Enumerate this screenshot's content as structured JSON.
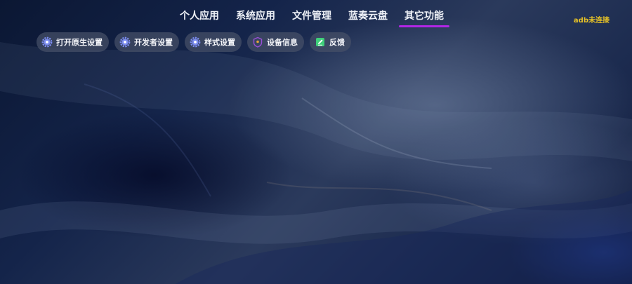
{
  "header": {
    "tabs": [
      {
        "label": "个人应用"
      },
      {
        "label": "系统应用"
      },
      {
        "label": "文件管理"
      },
      {
        "label": "蓝奏云盘"
      },
      {
        "label": "其它功能",
        "active": true
      }
    ],
    "adb_status": "adb未连接"
  },
  "toolbar": {
    "items": [
      {
        "label": "打开原生设置",
        "icon": "gear-icon"
      },
      {
        "label": "开发者设置",
        "icon": "gear-icon"
      },
      {
        "label": "样式设置",
        "icon": "gear-icon"
      },
      {
        "label": "设备信息",
        "icon": "location-pin-icon"
      },
      {
        "label": "反馈",
        "icon": "edit-icon"
      }
    ]
  },
  "colors": {
    "active_tab_indicator": "#b326e6",
    "adb_status_text": "#e7c226",
    "chip_background": "#464f68",
    "gear_icon": "#7b8cf0",
    "pin_icon": "#9a4fd8",
    "edit_icon": "#3fcf7a"
  }
}
